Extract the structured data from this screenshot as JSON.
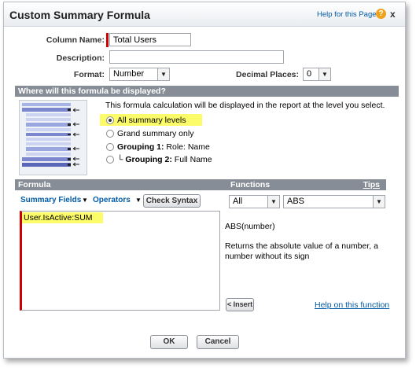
{
  "dialog": {
    "title": "Custom Summary Formula",
    "help_link": "Help for this Page",
    "help_icon": "?",
    "close_icon": "x"
  },
  "form": {
    "column_name_label": "Column Name:",
    "column_name_value": "Total Users",
    "description_label": "Description:",
    "description_value": "",
    "format_label": "Format:",
    "format_value": "Number",
    "decimal_label": "Decimal Places:",
    "decimal_value": "0"
  },
  "display_section": {
    "header": "Where will this formula be displayed?",
    "instruction": "This formula calculation will be displayed in the report at the level you select.",
    "options": [
      {
        "label": "All summary levels",
        "selected": true
      },
      {
        "label": "Grand summary only",
        "selected": false
      },
      {
        "bold": "Grouping 1:",
        "rest": " Role: Name",
        "selected": false
      },
      {
        "prefix": "└ ",
        "bold": "Grouping 2:",
        "rest": " Full Name",
        "selected": false
      }
    ]
  },
  "formula_section": {
    "formula_header": "Formula",
    "functions_header": "Functions",
    "tips_link": "Tips",
    "summary_fields": "Summary Fields",
    "operators": "Operators",
    "check_syntax": "Check Syntax",
    "formula_text": "User.IsActive:SUM",
    "function_category": "All",
    "function_name": "ABS",
    "function_signature": "ABS(number)",
    "function_description": "Returns the absolute value of a number, a number without its sign",
    "insert_button": "< Insert",
    "help_function_link": "Help on this function"
  },
  "footer": {
    "ok": "OK",
    "cancel": "Cancel"
  },
  "colors": {
    "section_bar": "#878d96",
    "highlight": "#fcfb6a",
    "link": "#015ba7",
    "required": "#cc0000"
  }
}
